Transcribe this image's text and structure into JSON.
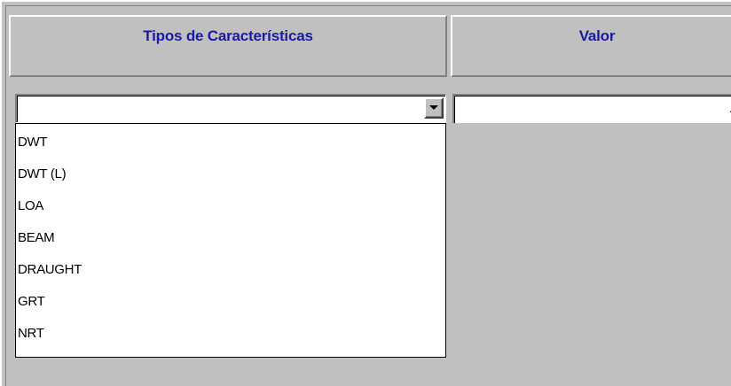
{
  "headers": {
    "tipos": "Tipos de Características",
    "valor": "Valor"
  },
  "combo": {
    "selected": "",
    "button_icon": "chevron-down-icon"
  },
  "value_field": {
    "value": "."
  },
  "dropdown": {
    "options": [
      "DWT",
      "DWT (L)",
      "LOA",
      "BEAM",
      "DRAUGHT",
      "GRT",
      "NRT"
    ]
  },
  "colors": {
    "header_text": "#1a1aa6",
    "background": "#c0c0c0",
    "field_background": "#ffffff"
  }
}
